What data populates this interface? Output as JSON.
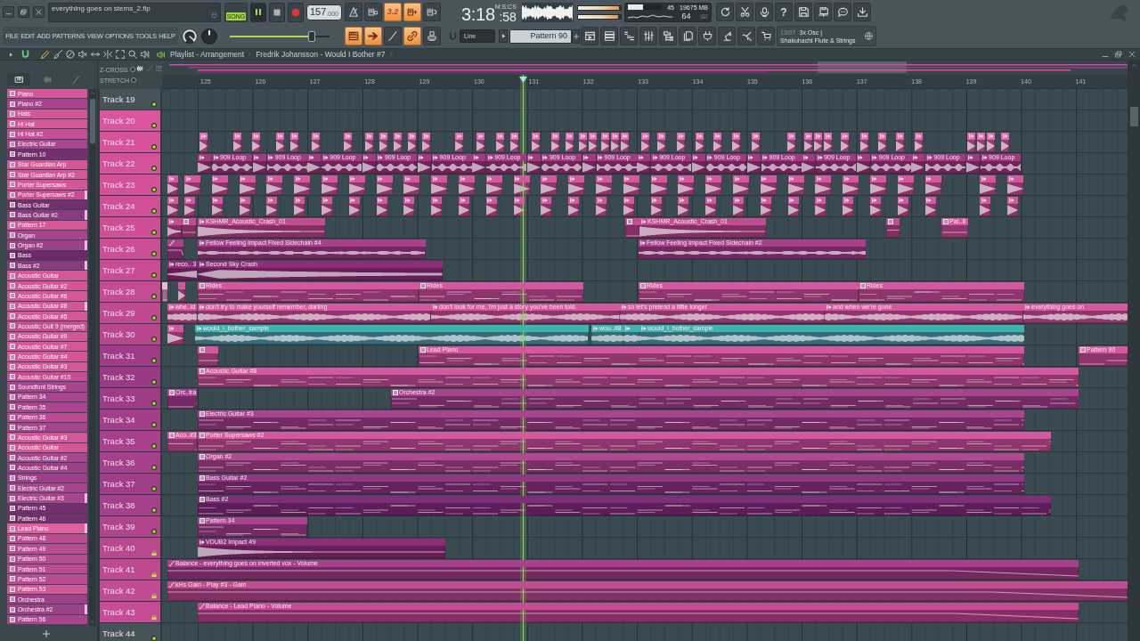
{
  "toolbar": {
    "project_title": "everything goes on stems_2.flp",
    "menu": [
      "FILE",
      "EDIT",
      "ADD",
      "PATTERNS",
      "VIEW",
      "OPTIONS",
      "TOOLS",
      "HELP"
    ],
    "mode": {
      "label": "SONG",
      "on": true
    },
    "playing": true,
    "tempo": "157",
    "tempo_decimals": ".000",
    "master_volume": {
      "level": 0.82
    },
    "record_buttons": [
      {
        "on": false
      },
      {
        "on": false
      },
      {
        "label": "3.2",
        "on": true
      },
      {
        "on": true
      },
      {
        "on": false
      }
    ],
    "snap_buttons": [
      {
        "on": true
      },
      {
        "on": true
      },
      {
        "on": false
      },
      {
        "on": true
      },
      {
        "on": false
      }
    ],
    "time": "3:18",
    "time_fraction": ":58",
    "time_format": "M:S:CS",
    "peak_meter": [
      {
        "level": 0.96
      },
      {
        "level": 0.94
      }
    ],
    "cpu": {
      "level": 0.45,
      "reading": "45"
    },
    "memory": "19675 MB",
    "polyphony": "64",
    "help_label": "?",
    "snap": "Line",
    "pattern": "Pattern 90",
    "hint": {
      "date": "13/07",
      "title": "3x Osc |",
      "text": "Shakuhachi Flute & Strings"
    }
  },
  "playlist": {
    "title": "Playlist - Arrangement",
    "arrangement": "Fredrik Johansson - Would I Bother #7",
    "snap_on": true,
    "tools": [
      {
        "selected": true
      },
      {
        "selected": false
      },
      {
        "selected": false
      },
      {
        "selected": false
      },
      {
        "selected": false
      },
      {
        "selected": false
      },
      {
        "selected": false
      },
      {
        "selected": false
      },
      {
        "selected": false
      }
    ],
    "picker_tabs": [
      {
        "selected": true
      },
      {
        "selected": false
      },
      {
        "selected": false
      }
    ],
    "options": [
      {
        "label": "Z-CROSS",
        "checked": false
      },
      {
        "label": "STRETCH",
        "checked": false
      }
    ],
    "ruler": [
      "125",
      "126",
      "127",
      "128",
      "129",
      "130",
      "131",
      "132",
      "133",
      "134",
      "135",
      "136",
      "137",
      "138",
      "139",
      "140",
      "141"
    ],
    "patterns": [
      {
        "name": "Piano",
        "color": "#d4579a",
        "marked": false
      },
      {
        "name": "Piano #2",
        "color": "#a8458e",
        "marked": false
      },
      {
        "name": "Hats",
        "color": "#d4579a",
        "marked": false
      },
      {
        "name": "Hi Hat",
        "color": "#d4579a",
        "marked": false
      },
      {
        "name": "Hi Hat #2",
        "color": "#c54f92",
        "marked": false
      },
      {
        "name": "Electric Guitar",
        "color": "#a8458e",
        "marked": false
      },
      {
        "name": "Pattern 10",
        "color": "#74306e",
        "marked": false
      },
      {
        "name": "Star Guardian Arp",
        "color": "#d4579a",
        "marked": false
      },
      {
        "name": "Star Guardian Arp #2",
        "color": "#d4579a",
        "marked": false
      },
      {
        "name": "Porter Supersaws",
        "color": "#d4579a",
        "marked": false
      },
      {
        "name": "Porter Supersaws #2",
        "color": "#c54f92",
        "marked": true
      },
      {
        "name": "Bass Guitar",
        "color": "#74306e",
        "marked": false
      },
      {
        "name": "Bass Guitar #2",
        "color": "#8a3a7e",
        "marked": true
      },
      {
        "name": "Pattern 17",
        "color": "#d4579a",
        "marked": false
      },
      {
        "name": "Organ",
        "color": "#a8458e",
        "marked": false
      },
      {
        "name": "Organ #2",
        "color": "#9c4088",
        "marked": true
      },
      {
        "name": "Bass",
        "color": "#6c2a69",
        "marked": false
      },
      {
        "name": "Bass #2",
        "color": "#8a3a7e",
        "marked": true
      },
      {
        "name": "Acoustic Guitar",
        "color": "#d4579a",
        "marked": false
      },
      {
        "name": "Acoustic Guitar #2",
        "color": "#d4579a",
        "marked": false
      },
      {
        "name": "Acoustic Guitar #6",
        "color": "#d4579a",
        "marked": false
      },
      {
        "name": "Acoustic Guitar #8",
        "color": "#d4579a",
        "marked": true
      },
      {
        "name": "Acoustic Guitar #5",
        "color": "#d4579a",
        "marked": false
      },
      {
        "name": "Acoustic Guit 9 (merged)",
        "color": "#c54f92",
        "marked": false
      },
      {
        "name": "Acoustic Guitar #9",
        "color": "#d4579a",
        "marked": false
      },
      {
        "name": "Acoustic Guitar #7",
        "color": "#d4579a",
        "marked": false
      },
      {
        "name": "Acoustic Guitar #4",
        "color": "#d4579a",
        "marked": false
      },
      {
        "name": "Acoustic Guitar #3",
        "color": "#d4579a",
        "marked": false
      },
      {
        "name": "Acoustic Guitar #10",
        "color": "#c54f92",
        "marked": false
      },
      {
        "name": "Soundfont Strings",
        "color": "#a8458e",
        "marked": false
      },
      {
        "name": "Pattern 34",
        "color": "#a8458e",
        "marked": false
      },
      {
        "name": "Pattern 35",
        "color": "#a8458e",
        "marked": false
      },
      {
        "name": "Pattern 36",
        "color": "#b84c92",
        "marked": false
      },
      {
        "name": "Pattern 37",
        "color": "#a8458e",
        "marked": false
      },
      {
        "name": "Acoustic Guitar #3",
        "color": "#d4579a",
        "marked": false
      },
      {
        "name": "Acoustic Guitar",
        "color": "#d4579a",
        "marked": false
      },
      {
        "name": "Acoustic Guitar #2",
        "color": "#a8458e",
        "marked": false
      },
      {
        "name": "Acoustic Guitar #4",
        "color": "#9c4088",
        "marked": false
      },
      {
        "name": "Strings",
        "color": "#9c4088",
        "marked": false
      },
      {
        "name": "Electric Guitar #2",
        "color": "#a8458e",
        "marked": false
      },
      {
        "name": "Electric Guitar #3",
        "color": "#a8458e",
        "marked": true
      },
      {
        "name": "Pattern 45",
        "color": "#74306e",
        "marked": false
      },
      {
        "name": "Pattern 46",
        "color": "#74306e",
        "marked": false
      },
      {
        "name": "Lead Piano",
        "color": "#e0609f",
        "marked": true
      },
      {
        "name": "Pattern 48",
        "color": "#b84c92",
        "marked": false
      },
      {
        "name": "Pattern 49",
        "color": "#b84c92",
        "marked": false
      },
      {
        "name": "Pattern 50",
        "color": "#b84c92",
        "marked": false
      },
      {
        "name": "Pattern 51",
        "color": "#b84c92",
        "marked": false
      },
      {
        "name": "Pattern 52",
        "color": "#b84c92",
        "marked": false
      },
      {
        "name": "Pattern 53",
        "color": "#d4579a",
        "marked": false
      },
      {
        "name": "Orchestra",
        "color": "#9c4088",
        "marked": false
      },
      {
        "name": "Orchestra #2",
        "color": "#9c4088",
        "marked": true
      },
      {
        "name": "Pattern 56",
        "color": "#a8458e",
        "marked": false
      }
    ],
    "tracks": [
      {
        "name": "Track 19",
        "color": "#46545a",
        "locked": false
      },
      {
        "name": "Track 20",
        "color": "#d9559c",
        "locked": false
      },
      {
        "name": "Track 21",
        "color": "#d6539a",
        "locked": false,
        "clips": [
          {
            "kind": "hits",
            "color": "#e466ad"
          }
        ]
      },
      {
        "name": "Track 22",
        "color": "#d4529a",
        "locked": false,
        "clips": [
          {
            "kind": "hits",
            "color": "#a23a80"
          },
          {
            "kind": "audio",
            "label": "909 Loop",
            "color": "#a23a80"
          },
          {
            "kind": "audio",
            "label": "909 Loop",
            "color": "#a23a80"
          },
          {
            "kind": "audio",
            "label": "909 Loop",
            "color": "#a23a80"
          },
          {
            "kind": "audio",
            "label": "909 Loop",
            "color": "#a23a80"
          },
          {
            "kind": "audio",
            "label": "909 Loop",
            "color": "#a23a80"
          },
          {
            "kind": "audio",
            "label": "909 Loop",
            "color": "#a23a80"
          },
          {
            "kind": "audio",
            "label": "909 Loop",
            "color": "#a23a80"
          },
          {
            "kind": "audio",
            "label": "909 Loop",
            "color": "#a23a80"
          },
          {
            "kind": "audio",
            "label": "909 Loop",
            "color": "#a23a80"
          },
          {
            "kind": "audio",
            "label": "909 Loop",
            "color": "#a23a80"
          },
          {
            "kind": "audio",
            "label": "909 Loop",
            "color": "#a23a80"
          },
          {
            "kind": "audio",
            "label": "909 Loop",
            "color": "#a23a80"
          },
          {
            "kind": "audio",
            "label": "909 Loop",
            "color": "#a23a80"
          },
          {
            "kind": "audio",
            "label": "909 Loop",
            "color": "#a23a80"
          },
          {
            "kind": "audio",
            "label": "909 Loop",
            "color": "#a23a80"
          }
        ]
      },
      {
        "name": "Track 23",
        "color": "#d25199",
        "locked": false,
        "clips": [
          {
            "kind": "hits",
            "color": "#d4589d"
          }
        ]
      },
      {
        "name": "Track 24",
        "color": "#d05098",
        "locked": false,
        "clips": [
          {
            "kind": "hits",
            "color": "#d4589d"
          }
        ]
      },
      {
        "name": "Track 25",
        "color": "#ce4f97",
        "locked": false,
        "clips": [
          {
            "kind": "audio",
            "color": "#c04d90"
          },
          {
            "kind": "pattern",
            "color": "#c04d90"
          },
          {
            "kind": "audio",
            "label": "KSHMR_Acoustic_Crash_01",
            "color": "#c04d90"
          },
          {
            "kind": "pattern",
            "color": "#c04d90"
          },
          {
            "kind": "audio",
            "label": "KSHMR_Acoustic_Crash_01",
            "color": "#c04d90"
          },
          {
            "kind": "pattern",
            "color": "#c04d90"
          },
          {
            "kind": "pattern",
            "label": "Pat..8",
            "color": "#d4589d"
          }
        ]
      },
      {
        "name": "Track 26",
        "color": "#cc4e96",
        "locked": false,
        "clips": [
          {
            "kind": "automation",
            "color": "#a8418a"
          },
          {
            "kind": "audio",
            "label": "Fellow Feeling Impact Fixed Sidechain #4",
            "color": "#a8418a"
          },
          {
            "kind": "audio",
            "label": "Fellow Feeling Impact Fixed Sidechain #2",
            "color": "#a8418a"
          }
        ]
      },
      {
        "name": "Track 27",
        "color": "#c94d95",
        "locked": false,
        "clips": [
          {
            "kind": "audio",
            "label": "reco.. 3",
            "color": "#8d2f78"
          },
          {
            "kind": "audio",
            "label": "Second Sky Crash",
            "color": "#8d2f78"
          }
        ]
      },
      {
        "name": "Track 28",
        "color": "#c54c94",
        "locked": false,
        "clips": [
          {
            "kind": "pattern",
            "color": "#f2b3da"
          },
          {
            "kind": "audio",
            "color": "#d4589d"
          },
          {
            "kind": "pattern",
            "label": "Rides",
            "color": "#d4589d"
          },
          {
            "kind": "pattern",
            "label": "Rides",
            "color": "#d4589d"
          },
          {
            "kind": "pattern",
            "label": "Rides",
            "color": "#d4589d"
          },
          {
            "kind": "pattern",
            "label": "Rides",
            "color": "#d4589d"
          }
        ]
      },
      {
        "name": "Track 29",
        "color": "#c04a92",
        "locked": false,
        "clips": [
          {
            "kind": "audio",
            "label": "whe..id",
            "color": "#d4589d"
          },
          {
            "kind": "audio",
            "label": "don't try to make yourself remember, darling",
            "color": "#d4589d"
          },
          {
            "kind": "audio",
            "label": "don't look for me, i'm just a story you've been told.",
            "color": "#d4589d"
          },
          {
            "kind": "audio",
            "label": "so let's pretend a little longer",
            "color": "#d4589d"
          },
          {
            "kind": "audio",
            "label": "and when we're gone",
            "color": "#d4589d"
          },
          {
            "kind": "audio",
            "label": "everything goes on",
            "color": "#d4589d"
          }
        ]
      },
      {
        "name": "Track 30",
        "color": "#b84790",
        "locked": false,
        "clips": [
          {
            "kind": "audio",
            "color": "#d4589d"
          },
          {
            "kind": "audio",
            "label": "would_i_bother_sample",
            "color": "#3fb3b0"
          },
          {
            "kind": "audio",
            "label": "wou..#8",
            "color": "#3fb3b0"
          },
          {
            "kind": "audio",
            "color": "#3fb3b0"
          },
          {
            "kind": "audio",
            "label": "would_i_bother_sample",
            "color": "#3fb3b0"
          }
        ]
      },
      {
        "name": "Track 31",
        "color": "#9e3c88",
        "locked": false,
        "clips": [
          {
            "kind": "pattern",
            "color": "#d4589d"
          },
          {
            "kind": "pattern",
            "label": "Lead Piano",
            "color": "#d4589d"
          },
          {
            "kind": "pattern",
            "label": "Pattern 90",
            "color": "#d4589d"
          }
        ]
      },
      {
        "name": "Track 32",
        "color": "#9a3a86",
        "locked": false,
        "clips": [
          {
            "kind": "pattern",
            "label": "Acoustic Guitar #8",
            "color": "#d4589d"
          }
        ]
      },
      {
        "name": "Track 33",
        "color": "#9e3c88",
        "locked": false,
        "clips": [
          {
            "kind": "pattern",
            "label": "Orc..tra",
            "color": "#a8458e"
          },
          {
            "kind": "pattern",
            "label": "Orchestra #2",
            "color": "#a8458e"
          }
        ]
      },
      {
        "name": "Track 34",
        "color": "#a33f89",
        "locked": false,
        "clips": [
          {
            "kind": "pattern",
            "label": "Electric Guitar #3",
            "color": "#a8458e"
          }
        ]
      },
      {
        "name": "Track 35",
        "color": "#a8418b",
        "locked": false,
        "clips": [
          {
            "kind": "pattern",
            "label": "Aco..#3",
            "color": "#d4589d"
          },
          {
            "kind": "pattern",
            "label": "Porter Supersaws #2",
            "color": "#d4589d"
          }
        ]
      },
      {
        "name": "Track 36",
        "color": "#a5408a",
        "locked": false,
        "clips": [
          {
            "kind": "pattern",
            "label": "Organ #2",
            "color": "#b04a90"
          }
        ]
      },
      {
        "name": "Track 37",
        "color": "#a03e88",
        "locked": false,
        "clips": [
          {
            "kind": "pattern",
            "label": "Bass Guitar #2",
            "color": "#8e3782"
          }
        ]
      },
      {
        "name": "Track 38",
        "color": "#a5408a",
        "locked": false,
        "clips": [
          {
            "kind": "pattern",
            "label": "Bass #2",
            "color": "#7e2f7a"
          }
        ]
      },
      {
        "name": "Track 39",
        "color": "#b0458d",
        "locked": false,
        "clips": [
          {
            "kind": "pattern",
            "label": "Pattern 34",
            "color": "#a8458e"
          }
        ]
      },
      {
        "name": "Track 40",
        "color": "#b8488f",
        "locked": true,
        "clips": [
          {
            "kind": "audio",
            "label": "VDUB2 Impact 49",
            "color": "#8d2f78"
          }
        ]
      },
      {
        "name": "Track 41",
        "color": "#bd4a91",
        "locked": true,
        "clips": [
          {
            "kind": "automation",
            "label": "Balance - everything goes on inverted vox - Volume",
            "color": "#a8418a"
          }
        ]
      },
      {
        "name": "Track 42",
        "color": "#c24c93",
        "locked": true,
        "clips": [
          {
            "kind": "automation",
            "label": "kHs Gain - Play #3 - Gain",
            "color": "#c04d90"
          }
        ]
      },
      {
        "name": "Track 43",
        "color": "#c64d95",
        "locked": true,
        "clips": [
          {
            "kind": "automation",
            "label": "Balance - Lead Piano - Volume",
            "color": "#c64d95"
          }
        ]
      },
      {
        "name": "Track 44",
        "color": "#46545a",
        "locked": false
      }
    ]
  }
}
